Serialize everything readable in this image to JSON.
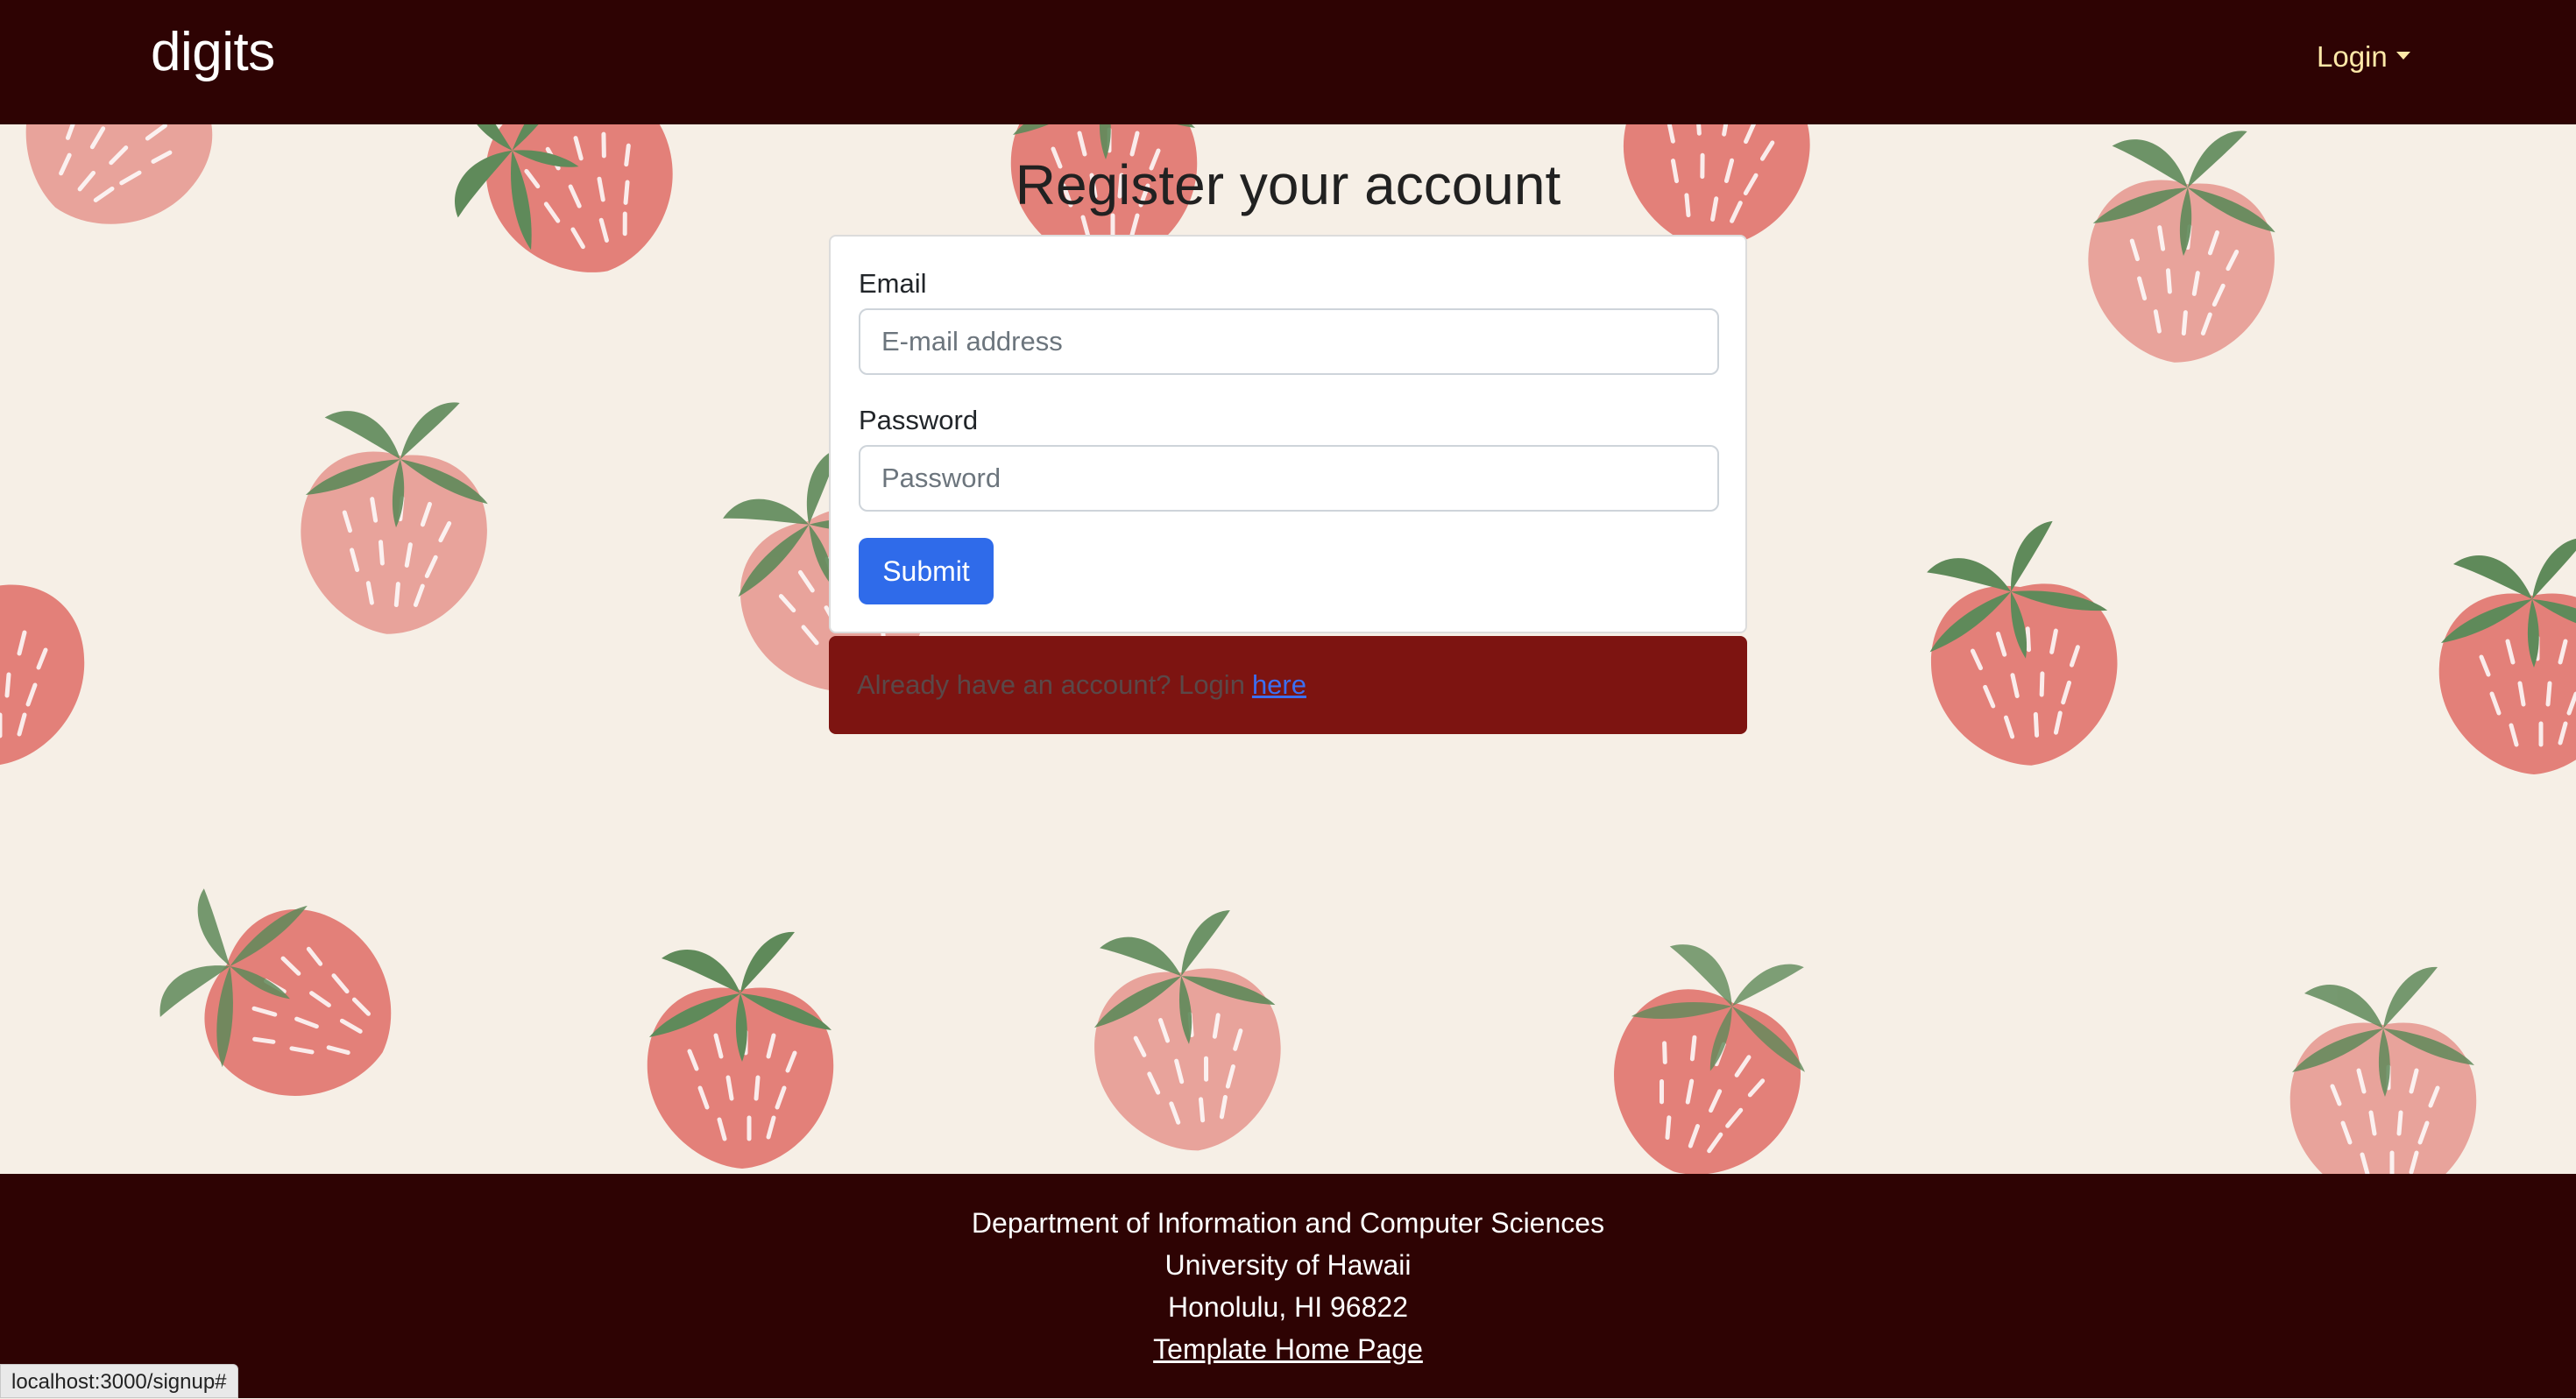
{
  "navbar": {
    "brand": "digits",
    "login_label": "Login"
  },
  "form": {
    "title": "Register your account",
    "email_label": "Email",
    "email_placeholder": "E-mail address",
    "password_label": "Password",
    "password_placeholder": "Password",
    "submit_label": "Submit"
  },
  "message": {
    "text": "Already have an account? Login",
    "link_label": "here"
  },
  "footer": {
    "line1": "Department of Information and Computer Sciences",
    "line2": "University of Hawaii",
    "line3": "Honolulu, HI 96822",
    "link_label": "Template Home Page"
  },
  "status_bar": {
    "url": "localhost:3000/signup#"
  },
  "colors": {
    "navbar": "#2e0303",
    "background": "#f6efe6",
    "strawberry": "#e38079",
    "strawberry_light": "#e8a39b",
    "leaf": "#5f8a5a",
    "submit": "#2f6bea",
    "message_bg": "#7d1411"
  }
}
